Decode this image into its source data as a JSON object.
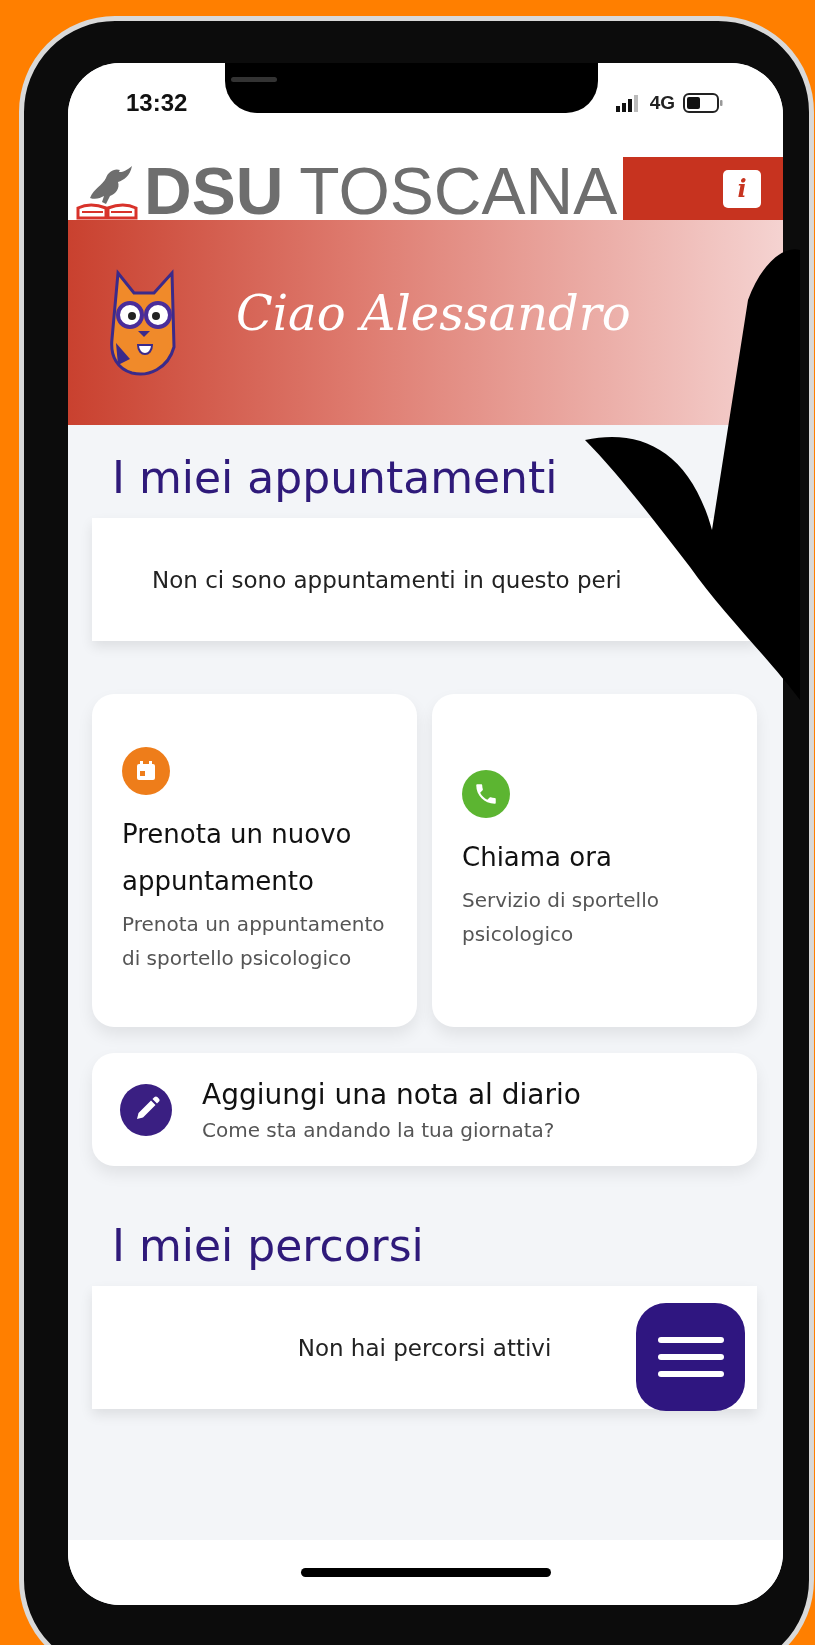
{
  "status_bar": {
    "time": "13:32",
    "network": "4G"
  },
  "header": {
    "logo_bold": "DSU",
    "logo_light": "TOSCANA",
    "info_button": "i",
    "greeting": "Ciao Alessandro"
  },
  "appointments": {
    "title": "I miei appuntamenti",
    "empty_message": "Non ci sono appuntamenti in questo peri"
  },
  "tiles": [
    {
      "kind": "calendar",
      "title": "Prenota un nuovo appuntamento",
      "subtitle": "Prenota un appuntamento di sportello psicologico",
      "color": "#ee7d1a"
    },
    {
      "kind": "phone",
      "title": "Chiama ora",
      "subtitle": "Servizio di sportello psicologico",
      "color": "#5cb531"
    }
  ],
  "diary": {
    "title": "Aggiungi una nota al diario",
    "subtitle": "Come sta andando la tua giornata?"
  },
  "paths": {
    "title": "I miei percorsi",
    "empty_message": "Non hai percorsi attivi"
  }
}
